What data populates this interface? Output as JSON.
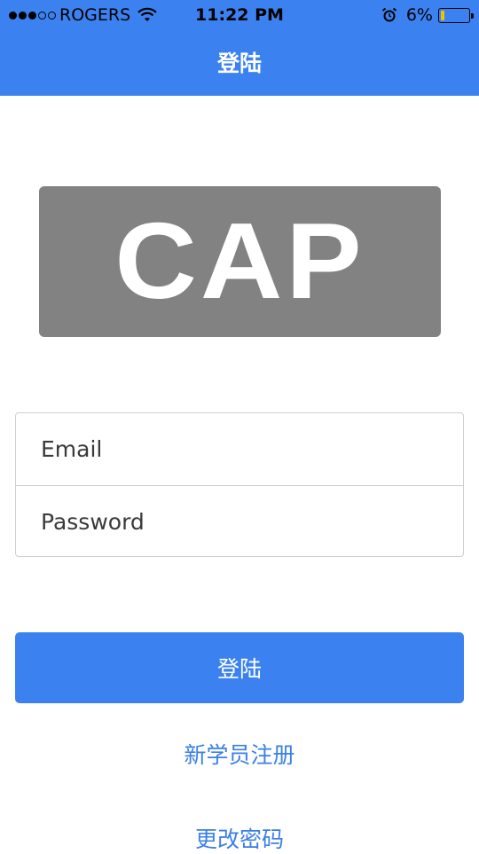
{
  "status_bar": {
    "carrier": "ROGERS",
    "time": "11:22 PM",
    "battery_percent": "6%",
    "battery_level": 0.06,
    "signal_bars_filled": 3,
    "signal_bars_total": 5,
    "icons": [
      "wifi-icon",
      "alarm-icon",
      "battery-icon"
    ]
  },
  "nav": {
    "title": "登陆"
  },
  "logo": {
    "text": "CAP"
  },
  "form": {
    "email_placeholder": "Email",
    "password_placeholder": "Password"
  },
  "actions": {
    "login_label": "登陆",
    "register_label": "新学员注册",
    "change_password_label": "更改密码"
  },
  "colors": {
    "primary": "#3b82f0",
    "link": "#3b7fe6",
    "logo_bg": "#828282",
    "battery": "#f2c200"
  }
}
